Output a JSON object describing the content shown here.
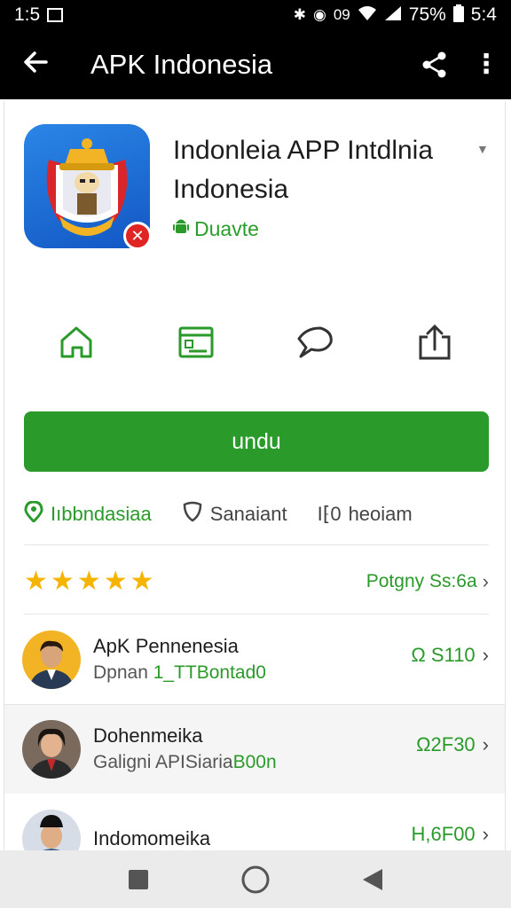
{
  "status_bar": {
    "time_left": "1:5",
    "carrier_icon": "notification-box-icon",
    "icons": [
      "bluetooth-icon",
      "vibrate-icon",
      "wifi-icon",
      "signal-icon"
    ],
    "network_label": "09",
    "battery": "75%",
    "time_right": "5:4"
  },
  "app_bar": {
    "back_icon": "arrow-left-icon",
    "title": "APK Indonesia",
    "share_icon": "share-icon",
    "more_icon": "more-vert-icon"
  },
  "app": {
    "title": "Indonleia APP Intdlnia Indonesia",
    "developer": "Duavte",
    "developer_icon": "android-icon",
    "badge_icon": "close-icon",
    "icon": "emblem-app-icon"
  },
  "actions": [
    {
      "icon": "home-icon"
    },
    {
      "icon": "screen-icon"
    },
    {
      "icon": "comment-icon"
    },
    {
      "icon": "share-upload-icon"
    }
  ],
  "download_button": {
    "label": "undu"
  },
  "tags": [
    {
      "label": "Iıbbndasiaa",
      "icon": "location-icon"
    },
    {
      "label": "Sanaiant",
      "icon": "shield-icon"
    },
    {
      "label": "heoiam",
      "icon": "info-icon",
      "prefix": "I⁅0"
    }
  ],
  "rating": {
    "stars": 5,
    "link_label": "Potgny Ss:6a",
    "chevron": "chevron-right-icon"
  },
  "reviews": [
    {
      "name": "ApK Pennenesia",
      "sub_prefix": "Dpnan ",
      "sub_highlight": "1_TTBontad0",
      "score": "Ω S110"
    },
    {
      "name": "Dohenmeika",
      "sub_prefix": "Galigni APISiaria",
      "sub_highlight": "B00n",
      "score": "Ω2F30"
    },
    {
      "name": "Indomomeika",
      "sub_prefix": "",
      "sub_highlight": "",
      "score": "H,6F00"
    }
  ],
  "colors": {
    "accent": "#2a9a2a",
    "star": "#f5b400",
    "app_bar": "#000000",
    "badge": "#e02424",
    "icon_blue": "#1a66d6"
  },
  "nav_bar": {
    "buttons": [
      "square-recent-icon",
      "circle-home-icon",
      "triangle-back-icon"
    ]
  }
}
